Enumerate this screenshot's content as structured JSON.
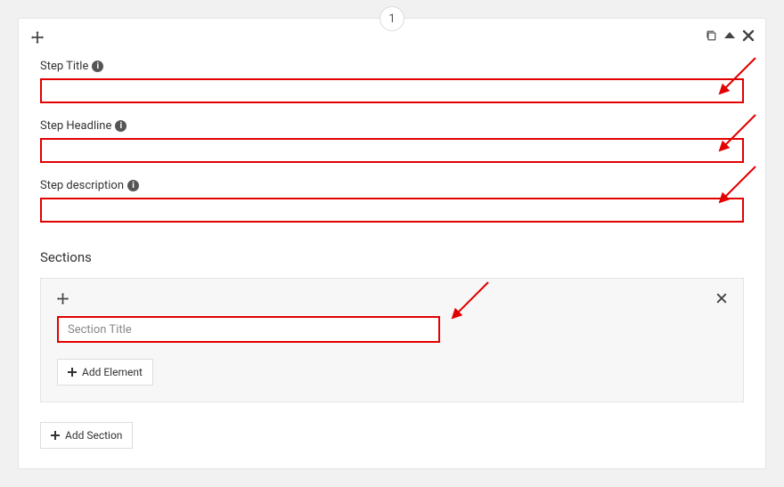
{
  "step": {
    "number": "1"
  },
  "labels": {
    "step_title": "Step Title",
    "step_headline": "Step Headline",
    "step_description": "Step description"
  },
  "values": {
    "step_title": "",
    "step_headline": "",
    "step_description": ""
  },
  "sections": {
    "heading": "Sections",
    "title_placeholder": "Section Title",
    "title_value": "",
    "add_element": "Add Element",
    "add_section": "Add Section"
  },
  "info_glyph": "i"
}
